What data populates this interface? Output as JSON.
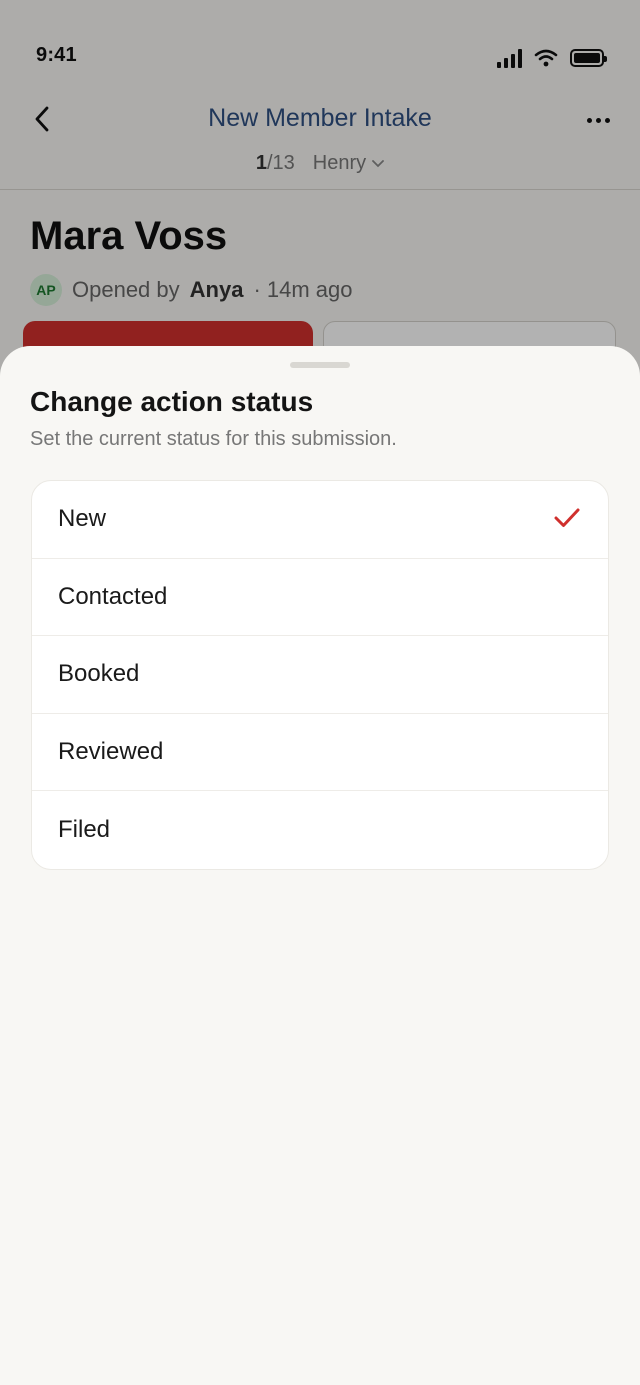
{
  "status_bar": {
    "time": "9:41"
  },
  "nav": {
    "back_icon": "chevron-left-icon",
    "title": "New Member Intake",
    "more_icon": "more-horizontal-icon"
  },
  "pager": {
    "current": "1",
    "total": "/13",
    "assignee": "Henry",
    "assignee_icon": "chevron-down-icon"
  },
  "record": {
    "name": "Mara Voss",
    "avatar_initials": "AP",
    "opened_prefix": "Opened by",
    "opened_by": "Anya",
    "opened_suffix": "· 14m ago"
  },
  "sheet": {
    "title": "Change action status",
    "subtitle": "Set the current status for this submission.",
    "selected": "New",
    "options": [
      {
        "label": "New",
        "selected": true
      },
      {
        "label": "Contacted",
        "selected": false
      },
      {
        "label": "Booked",
        "selected": false
      },
      {
        "label": "Reviewed",
        "selected": false
      },
      {
        "label": "Filed",
        "selected": false
      }
    ]
  },
  "colors": {
    "accent": "#d0302d",
    "title_blue": "#2f4f82",
    "avatar_green": "#1e7a32"
  }
}
